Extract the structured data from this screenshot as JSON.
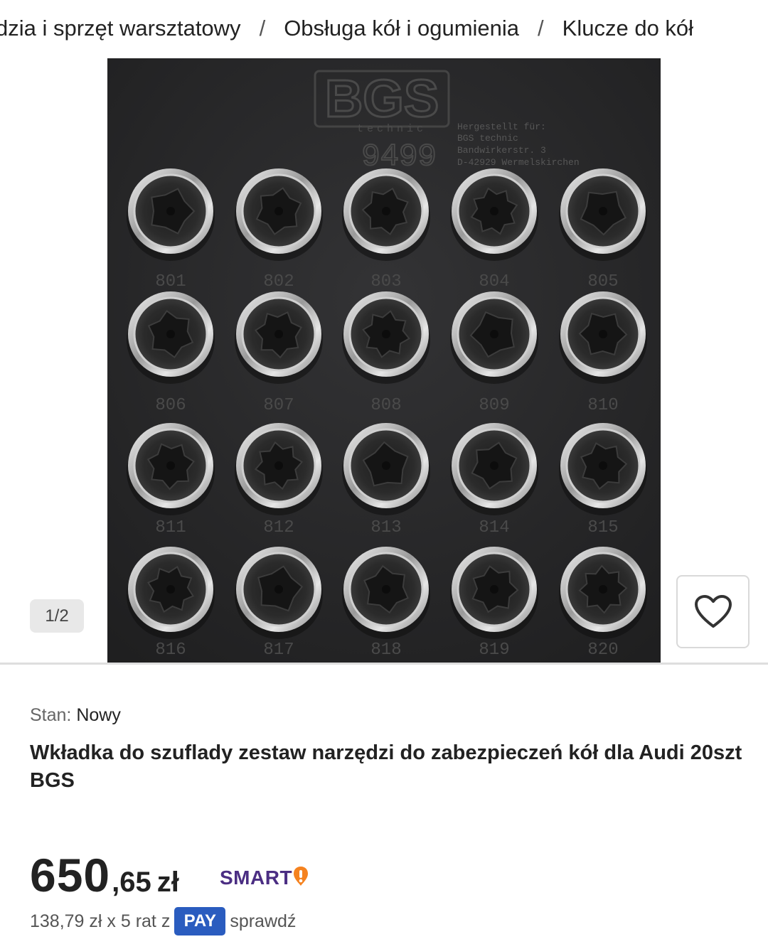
{
  "breadcrumb": {
    "items": [
      "dzia i sprzęt warsztatowy",
      "Obsługa kół i ogumienia",
      "Klucze do kół"
    ],
    "separator": "/"
  },
  "gallery": {
    "pager": "1/2",
    "photo": {
      "brand_logo_text": "BGS",
      "brand_sub": "technic",
      "model_number": "9499",
      "maker_lines": [
        "Hergestellt für:",
        "BGS technic",
        "Bandwirkerstr. 3",
        "D-42929 Wermelskirchen"
      ],
      "socket_labels": [
        "801",
        "802",
        "803",
        "804",
        "805",
        "806",
        "807",
        "808",
        "809",
        "810",
        "811",
        "812",
        "813",
        "814",
        "815",
        "816",
        "817",
        "818",
        "819",
        "820"
      ]
    }
  },
  "favorite": {
    "icon": "heart-icon"
  },
  "product": {
    "condition_label": "Stan:",
    "condition_value": "Nowy",
    "title": "Wkładka do szuflady zestaw narzędzi do zabezpieczeń kół dla Audi 20szt BGS"
  },
  "price": {
    "integer": "650",
    "decimal": ",65",
    "currency": "zł",
    "smart_label": "SMART",
    "smart_color": "#4b2e83",
    "smart_accent": "#f5821f"
  },
  "installments": {
    "text": "138,79 zł x 5 rat z",
    "pay_label": "PAY",
    "pay_color": "#2a5cbf",
    "check_label": "sprawdź"
  }
}
